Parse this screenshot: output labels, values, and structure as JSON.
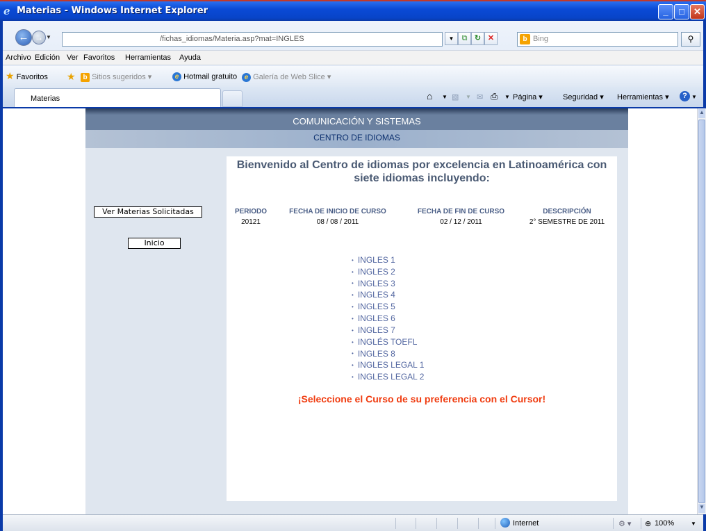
{
  "window": {
    "title": "Materias - Windows Internet Explorer"
  },
  "address": {
    "url": "/fichas_idiomas/Materia.asp?mat=INGLES"
  },
  "search": {
    "placeholder": "Bing"
  },
  "menu": [
    "Archivo",
    "Edición",
    "Ver",
    "Favoritos",
    "Herramientas",
    "Ayuda"
  ],
  "favorites": {
    "label": "Favoritos",
    "sitios": "Sitios sugeridos ▾",
    "hotmail": "Hotmail gratuito",
    "galeria": "Galería de Web Slice ▾"
  },
  "tab": {
    "label": "Materias"
  },
  "commands": {
    "pagina": "Página ▾",
    "seguridad": "Seguridad ▾",
    "herramientas": "Herramientas ▾"
  },
  "site": {
    "header1": "COMUNICACIÓN Y SISTEMAS",
    "header2": "CENTRO DE IDIOMAS",
    "welcome": "Bienvenido al Centro de idiomas por excelencia en Latinoamérica con siete idiomas incluyendo:",
    "buttons": {
      "ver": "Ver Materias Solicitadas",
      "inicio": "Inicio"
    },
    "columns": {
      "periodo": {
        "label": "PERIODO",
        "value": "20121"
      },
      "inicio": {
        "label": "FECHA DE INICIO DE CURSO",
        "value": "08 / 08 / 2011"
      },
      "fin": {
        "label": "FECHA DE FIN DE CURSO",
        "value": "02 / 12 / 2011"
      },
      "desc": {
        "label": "DESCRIPCIÓN",
        "value": "2° SEMESTRE DE 2011"
      }
    },
    "courses": [
      "INGLES 1",
      "INGLES 2",
      "INGLES 3",
      "INGLES 4",
      "INGLES 5",
      "INGLES 6",
      "INGLES 7",
      "INGLÉS TOEFL",
      "INGLES 8",
      "INGLES LEGAL 1",
      "INGLES LEGAL 2"
    ],
    "cta": "¡Seleccione el Curso de su preferencia con el Cursor!"
  },
  "status": {
    "zone": "Internet",
    "zoom": "100%"
  },
  "icons": [
    "ie-logo-icon",
    "back-arrow-icon",
    "forward-arrow-icon",
    "refresh-icon",
    "stop-icon",
    "search-icon",
    "home-icon",
    "print-icon",
    "help-icon",
    "globe-icon",
    "zoom-icon"
  ]
}
